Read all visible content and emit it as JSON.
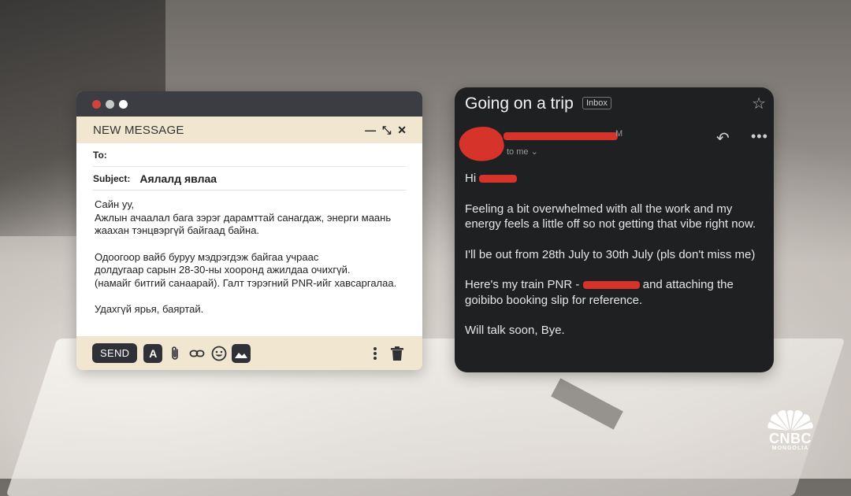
{
  "compose": {
    "header_title": "NEW MESSAGE",
    "to_label": "To:",
    "to_value": "",
    "subject_label": "Subject:",
    "subject_value": "Аялалд явлаа",
    "body": [
      "Сайн уу,\nАжлын ачаалал бага зэрэг дарамттай санагдаж, энерги маань жаахан тэнцвэргүй байгаад байна.",
      "Одоогоор вайб буруу мэдрэгдэж байгаа учраас\nдолдугаар сарын 28-30-ны хооронд ажилдаа очихгүй.\n(намайг битгий санаарай). Галт тэрэгний PNR-ийг хавсаргалаа.",
      "Удахгүй ярья, баяртай."
    ],
    "send_label": "SEND",
    "format_label": "A",
    "icons": [
      "paperclip-icon",
      "link-icon",
      "emoji-icon",
      "image-icon",
      "more-vertical-icon",
      "trash-icon"
    ],
    "window_dot_colors": [
      "#d2443a",
      "#c9c9c9",
      "#ffffff"
    ]
  },
  "email": {
    "subject": "Going on a trip",
    "label": "Inbox",
    "sender_suffix": "M",
    "recipient": "to me ⌄",
    "greeting": "Hi",
    "paragraphs": [
      "Feeling a bit overwhelmed with all the work and my energy feels a little off so not getting that vibe right now.",
      "I'll be out from 28th July to 30th July (pls don't miss me)"
    ],
    "pnr_prefix": "Here's my train PNR - ",
    "pnr_suffix": "and attaching the goibibo booking slip for reference.",
    "closing": "Will talk soon, Bye.",
    "redaction_color": "#d6332a"
  },
  "brand": {
    "name": "CNBC",
    "sub": "MONGOLIA"
  }
}
